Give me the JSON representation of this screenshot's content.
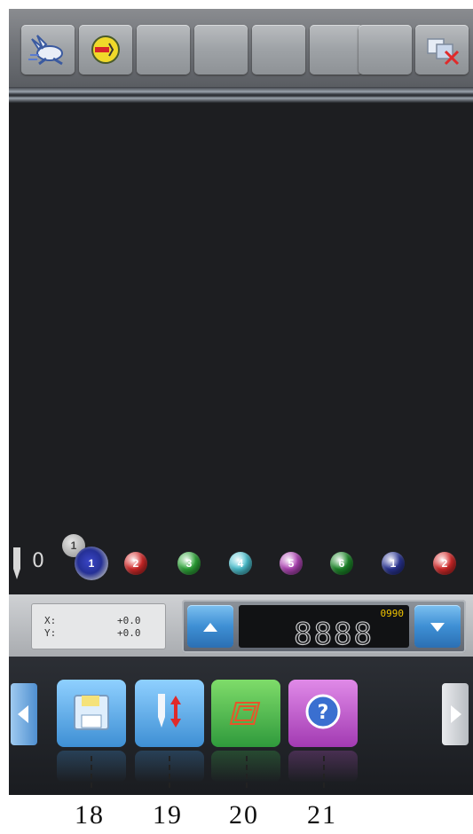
{
  "toolbar": {
    "buttons": [
      {
        "name": "speed-rabbit-button",
        "icon": "rabbit-icon"
      },
      {
        "name": "thread-trim-button",
        "icon": "thread-spool-icon"
      },
      {
        "name": "toolbar-empty-button-3",
        "icon": ""
      },
      {
        "name": "toolbar-empty-button-4",
        "icon": ""
      },
      {
        "name": "toolbar-empty-button-5",
        "icon": ""
      },
      {
        "name": "toolbar-empty-button-6",
        "icon": ""
      },
      {
        "name": "toolbar-empty-button-7",
        "icon": ""
      },
      {
        "name": "exit-button",
        "icon": "close-window-icon"
      }
    ]
  },
  "color_row": {
    "needle_count": "0",
    "current": {
      "badge": "1",
      "number": "1",
      "color": "#2a3596"
    },
    "colors": [
      {
        "number": "2",
        "color": "#d62a2a"
      },
      {
        "number": "3",
        "color": "#2fa83a"
      },
      {
        "number": "4",
        "color": "#4cc3d2"
      },
      {
        "number": "5",
        "color": "#b246b8"
      },
      {
        "number": "6",
        "color": "#1d8a2a"
      },
      {
        "number": "1",
        "color": "#2a3596"
      },
      {
        "number": "2",
        "color": "#d62a2a"
      }
    ]
  },
  "coordinates": {
    "x_label": "X:",
    "x_value": "+0.0",
    "y_label": "Y:",
    "y_value": "+0.0"
  },
  "counter": {
    "main_display": "8888",
    "small_display": "0990"
  },
  "function_buttons": [
    {
      "name": "save-button",
      "icon": "floppy-disk-icon",
      "callout": "18",
      "color": "#4fa3e6"
    },
    {
      "name": "needle-updown-button",
      "icon": "needle-updown-icon",
      "callout": "19",
      "color": "#4fa3e6"
    },
    {
      "name": "trace-button",
      "icon": "frame-trace-icon",
      "callout": "20",
      "color": "#3ab04a"
    },
    {
      "name": "help-button",
      "icon": "question-icon",
      "callout": "21",
      "color": "#b14fc0"
    }
  ],
  "colors": {
    "screen_bg": "#1d1e21",
    "accent_blue": "#3e8fd4",
    "toolbar_gray": "#9ea2a6"
  }
}
